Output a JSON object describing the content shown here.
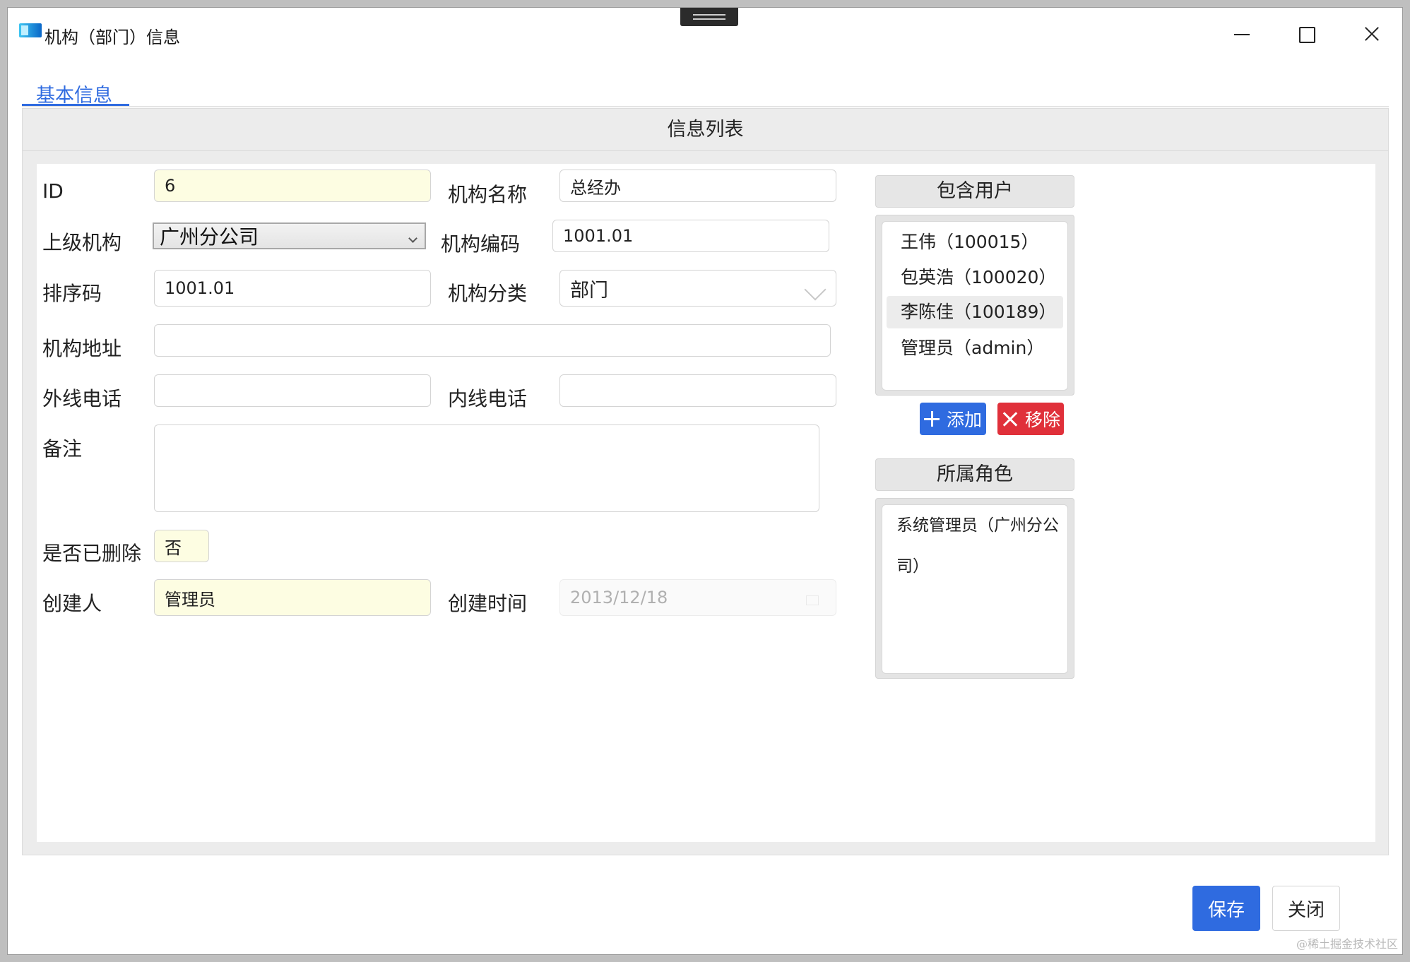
{
  "window": {
    "title": "机构（部门）信息"
  },
  "tabs": [
    {
      "label": "基本信息",
      "active": true
    }
  ],
  "panel": {
    "header": "信息列表"
  },
  "form": {
    "id": {
      "label": "ID",
      "value": "6"
    },
    "name": {
      "label": "机构名称",
      "value": "总经办"
    },
    "parent": {
      "label": "上级机构",
      "value": "广州分公司"
    },
    "code": {
      "label": "机构编码",
      "value": "1001.01"
    },
    "sort": {
      "label": "排序码",
      "value": "1001.01"
    },
    "category": {
      "label": "机构分类",
      "value": "部门"
    },
    "address": {
      "label": "机构地址",
      "value": ""
    },
    "outer_phone": {
      "label": "外线电话",
      "value": ""
    },
    "inner_phone": {
      "label": "内线电话",
      "value": ""
    },
    "remark": {
      "label": "备注",
      "value": ""
    },
    "deleted": {
      "label": "是否已删除",
      "value": "否"
    },
    "creator": {
      "label": "创建人",
      "value": "管理员"
    },
    "created_time": {
      "label": "创建时间",
      "value": "2013/12/18"
    }
  },
  "users": {
    "header": "包含用户",
    "items": [
      {
        "label": "王伟（100015）"
      },
      {
        "label": "包英浩（100020）"
      },
      {
        "label": "李陈佳（100189）",
        "selected": true
      },
      {
        "label": "管理员（admin）"
      }
    ],
    "add_label": "添加",
    "remove_label": "移除"
  },
  "roles": {
    "header": "所属角色",
    "items": [
      {
        "label": "系统管理员（广州分公司）"
      }
    ]
  },
  "footer": {
    "save_label": "保存",
    "close_label": "关闭"
  },
  "watermark": "@稀土掘金技术社区",
  "colors": {
    "primary": "#2f6be0",
    "danger": "#e0303a",
    "readonly_bg": "#fdfde2"
  }
}
